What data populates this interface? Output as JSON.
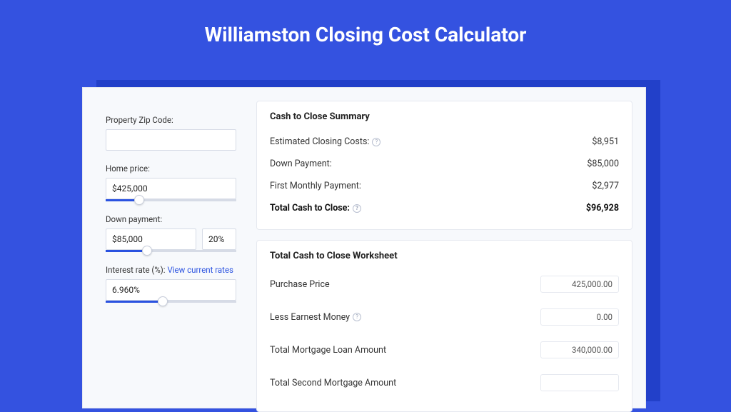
{
  "title": "Williamston Closing Cost Calculator",
  "form": {
    "zip": {
      "label": "Property Zip Code:",
      "value": ""
    },
    "homePrice": {
      "label": "Home price:",
      "value": "$425,000",
      "sliderFillPct": 22,
      "handlePct": 22
    },
    "downPayment": {
      "label": "Down payment:",
      "value": "$85,000",
      "pct": "20%",
      "sliderFillPct": 28,
      "handlePct": 28
    },
    "interestRate": {
      "label": "Interest rate (%):",
      "linkText": "View current rates",
      "value": "6.960%",
      "sliderFillPct": 40,
      "handlePct": 40
    }
  },
  "summary": {
    "title": "Cash to Close Summary",
    "rows": [
      {
        "label": "Estimated Closing Costs:",
        "value": "$8,951",
        "help": true
      },
      {
        "label": "Down Payment:",
        "value": "$85,000",
        "help": false
      },
      {
        "label": "First Monthly Payment:",
        "value": "$2,977",
        "help": false
      }
    ],
    "total": {
      "label": "Total Cash to Close:",
      "value": "$96,928",
      "help": true
    }
  },
  "worksheet": {
    "title": "Total Cash to Close Worksheet",
    "rows": [
      {
        "label": "Purchase Price",
        "value": "425,000.00",
        "help": false
      },
      {
        "label": "Less Earnest Money",
        "value": "0.00",
        "help": true
      },
      {
        "label": "Total Mortgage Loan Amount",
        "value": "340,000.00",
        "help": false
      },
      {
        "label": "Total Second Mortgage Amount",
        "value": "",
        "help": false
      }
    ]
  }
}
